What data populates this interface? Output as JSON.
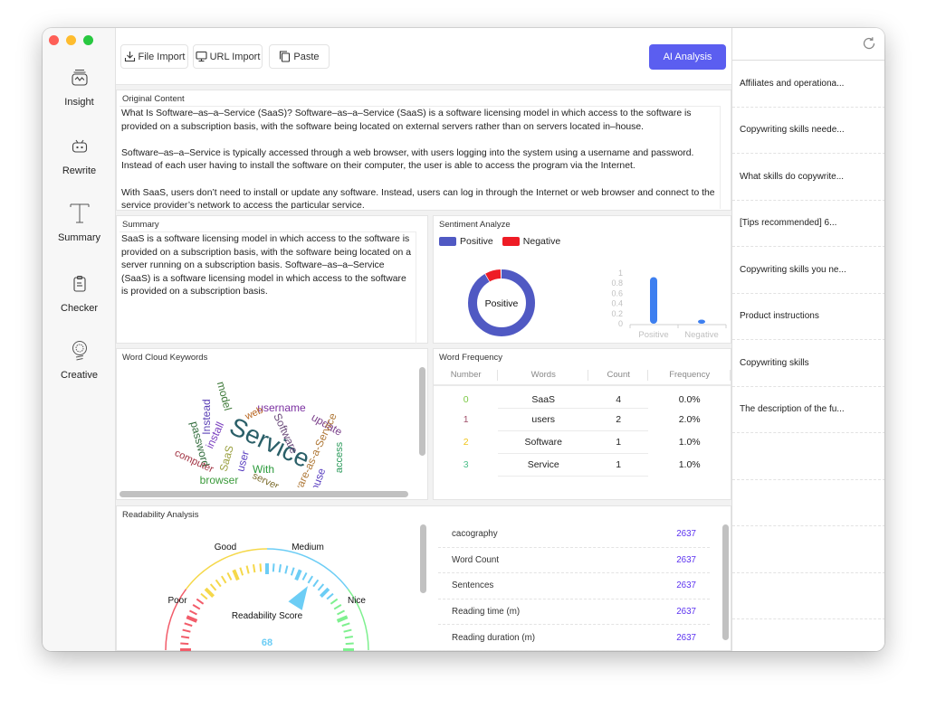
{
  "sidebar": {
    "items": [
      {
        "label": "Insight",
        "icon": "insight-chart-icon"
      },
      {
        "label": "Rewrite",
        "icon": "robot-icon"
      },
      {
        "label": "Summary",
        "icon": "text-t-icon"
      },
      {
        "label": "Checker",
        "icon": "clipboard-icon"
      },
      {
        "label": "Creative",
        "icon": "lightbulb-icon"
      }
    ]
  },
  "toolbar": {
    "file_import": "File Import",
    "url_import": "URL Import",
    "paste": "Paste",
    "ai_analysis": "AI Analysis",
    "accent": "#5b5ef0"
  },
  "original": {
    "title": "Original Content",
    "text": "What Is Software–as–a–Service (SaaS)? Software–as–a–Service (SaaS) is a software licensing model in which access to the software is provided on a subscription basis, with the software being located on external servers rather than on servers located in–house.\n\nSoftware–as–a–Service is typically accessed through a web browser, with users logging into the system using a username and password. Instead of each user having to install the software on their computer, the user is able to access the program via the Internet.\n\nWith SaaS, users don’t need to install or update any software. Instead, users can log in through the Internet or web browser and connect to the service provider’s network to access the particular service."
  },
  "summary": {
    "title": "Summary",
    "text": "SaaS is a software licensing model in which access to the software is provided on a subscription basis, with the software being located on a server running on a subscription basis. Software–as–a–Service (SaaS) is a software licensing model in which access to the software is provided on a subscription basis."
  },
  "sentiment": {
    "title": "Sentiment Analyze",
    "legend": [
      {
        "label": "Positive",
        "color": "#5059c3"
      },
      {
        "label": "Negative",
        "color": "#ee1c25"
      }
    ],
    "donut_center": "Positive",
    "positive": 0.92,
    "negative": 0.08,
    "bar_color": "#3d7ff0",
    "y_ticks": [
      "0",
      "0.2",
      "0.4",
      "0.6",
      "0.8",
      "1"
    ],
    "x_labels": [
      "Positive",
      "Negative"
    ]
  },
  "word_cloud": {
    "title": "Word Cloud Keywords",
    "words": [
      {
        "text": "Service",
        "color": "#2a5f68"
      },
      {
        "text": "username",
        "color": "#7a2fa0"
      },
      {
        "text": "update",
        "color": "#7a3f8a"
      },
      {
        "text": "model",
        "color": "#3f7a3a"
      },
      {
        "text": "Instead",
        "color": "#5a3fb5"
      },
      {
        "text": "install",
        "color": "#7a3fbf"
      },
      {
        "text": "web",
        "color": "#b8651f"
      },
      {
        "text": "Software",
        "color": "#6a4a7a"
      },
      {
        "text": "Software-as-a-Service",
        "color": "#b07a3a"
      },
      {
        "text": "password",
        "color": "#2f6a3a"
      },
      {
        "text": "computer",
        "color": "#a03040"
      },
      {
        "text": "SaaS",
        "color": "#9aa040"
      },
      {
        "text": "user",
        "color": "#5a3fc0"
      },
      {
        "text": "With",
        "color": "#2a9a3a"
      },
      {
        "text": "access",
        "color": "#2a9a5a"
      },
      {
        "text": "house",
        "color": "#5a3fc0"
      },
      {
        "text": "browser",
        "color": "#3a9a3a"
      },
      {
        "text": "server",
        "color": "#7a6a2a"
      }
    ]
  },
  "word_frequency": {
    "title": "Word Frequency",
    "columns": [
      "Number",
      "Words",
      "Count",
      "Frequency"
    ],
    "rows": [
      {
        "number": "0",
        "word": "SaaS",
        "count": "4",
        "frequency": "0.0%",
        "color": "#7ac943"
      },
      {
        "number": "1",
        "word": "users",
        "count": "2",
        "frequency": "2.0%",
        "color": "#a0506a"
      },
      {
        "number": "2",
        "word": "Software",
        "count": "1",
        "frequency": "1.0%",
        "color": "#f0c419"
      },
      {
        "number": "3",
        "word": "Service",
        "count": "1",
        "frequency": "1.0%",
        "color": "#4cbf8a"
      }
    ]
  },
  "readability": {
    "title": "Readability Analysis",
    "gauge_labels": {
      "poor": "Poor",
      "good": "Good",
      "medium": "Medium",
      "nice": "Nice"
    },
    "score_label": "Readability Score",
    "score": "68",
    "score_value": 68,
    "stats": [
      {
        "label": "cacography",
        "value": "2637"
      },
      {
        "label": "Word Count",
        "value": "2637"
      },
      {
        "label": "Sentences",
        "value": "2637"
      },
      {
        "label": "Reading time (m)",
        "value": "2637"
      },
      {
        "label": "Reading duration (m)",
        "value": "2637"
      }
    ]
  },
  "history": {
    "items": [
      "Affiliates and operationa...",
      "Copywriting skills neede...",
      "What skills do copywrite...",
      "[Tips recommended] 6...",
      "Copywriting skills you ne...",
      "Product instructions",
      "Copywriting skills",
      "The description of the fu...",
      "",
      "",
      "",
      ""
    ]
  }
}
